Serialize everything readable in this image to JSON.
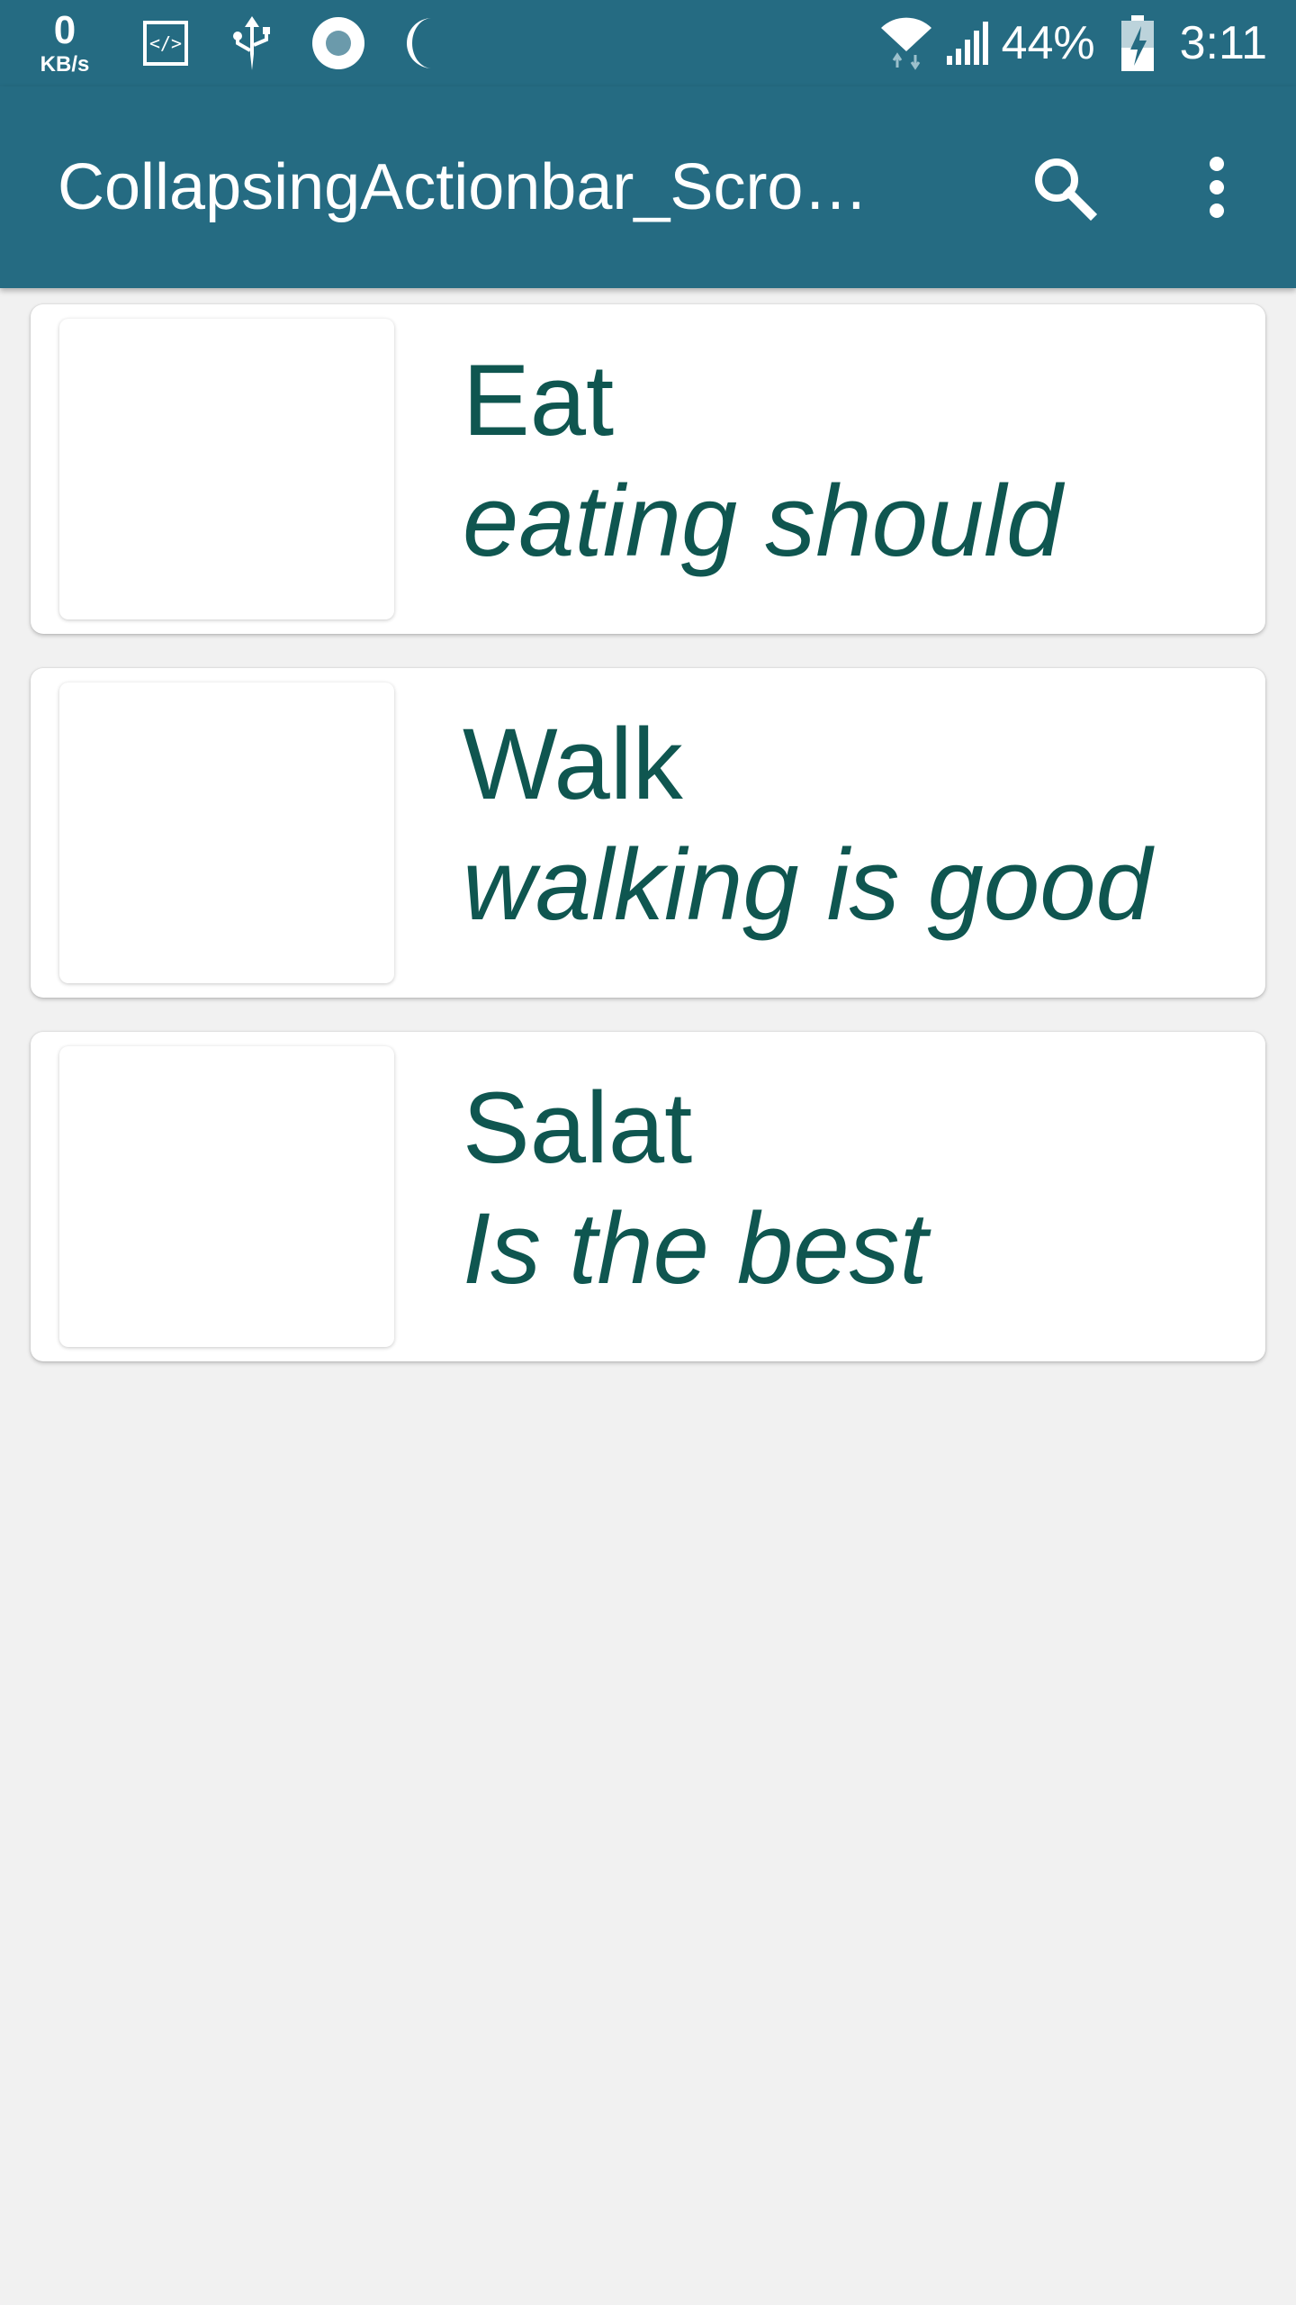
{
  "status_bar": {
    "speed_value": "0",
    "speed_unit": "KB/s",
    "left_icons": [
      "code-icon",
      "usb-icon",
      "record-icon",
      "moon-icon"
    ],
    "right_icons": [
      "wifi-icon",
      "signal-icon",
      "battery-charging-icon"
    ],
    "battery": "44%",
    "time": "3:11"
  },
  "app_bar": {
    "title": "CollapsingActionbar_Scro…",
    "actions": [
      "search-icon",
      "more-vert-icon"
    ],
    "color": "#256b82"
  },
  "list": {
    "items": [
      {
        "title": "Eat",
        "subtitle": "eating should"
      },
      {
        "title": "Walk",
        "subtitle": "walking is good"
      },
      {
        "title": "Salat",
        "subtitle": "Is the best"
      }
    ],
    "text_color": "#0f5650"
  }
}
